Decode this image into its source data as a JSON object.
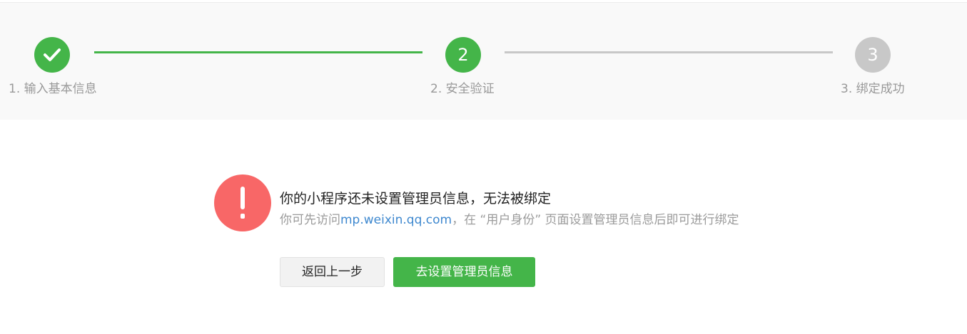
{
  "stepper": {
    "steps": [
      {
        "number": "",
        "label": "1. 输入基本信息",
        "state": "done",
        "icon": "check-icon"
      },
      {
        "number": "2",
        "label": "2. 安全验证",
        "state": "active"
      },
      {
        "number": "3",
        "label": "3. 绑定成功",
        "state": "pending"
      }
    ]
  },
  "message": {
    "icon": "exclamation-icon",
    "title": "你的小程序还未设置管理员信息，无法被绑定",
    "desc_prefix": "你可先访问",
    "desc_link": "mp.weixin.qq.com",
    "desc_suffix": "，在 “用户身份” 页面设置管理员信息后即可进行绑定"
  },
  "buttons": {
    "back_label": "返回上一步",
    "primary_label": "去设置管理员信息"
  },
  "colors": {
    "accent_green": "#44b549",
    "inactive_gray": "#c8c8c8",
    "warning_red": "#f86767",
    "link_blue": "#3e88cf"
  }
}
